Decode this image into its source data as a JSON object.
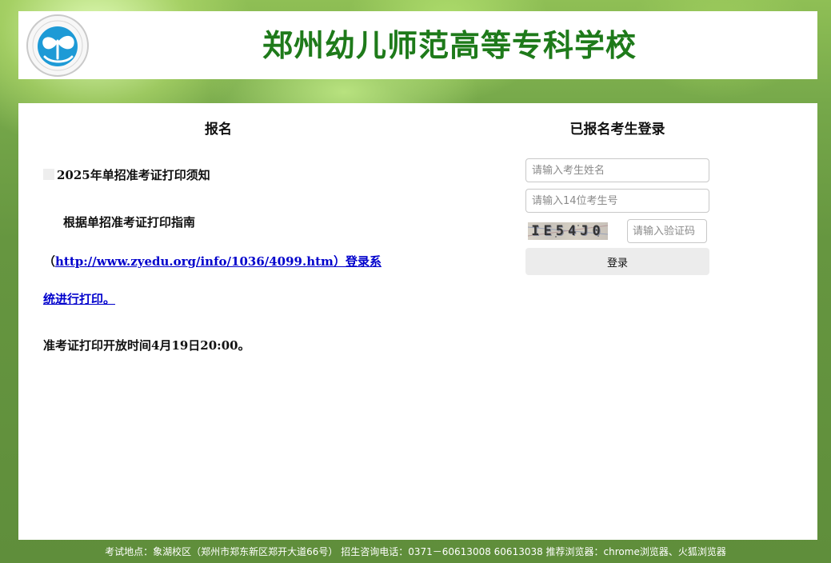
{
  "header": {
    "title": "郑州幼儿师范高等专科学校",
    "logo_icon": "school-logo-icon",
    "title_color": "#1e7a1a"
  },
  "registration": {
    "heading": "报名",
    "notice_title": "2025年单招准考证打印须知",
    "paragraph_intro": "根据单招准考证打印指南",
    "paragraph_open_paren": "（",
    "paragraph_link_url": "http://www.zyedu.org/info/1036/4099.htm",
    "paragraph_link_suffix": "）登录系",
    "paragraph_link_continued": "统进行打印。",
    "open_time_text": "准考证打印开放时间4月19日20:00。"
  },
  "login": {
    "heading": "已报名考生登录",
    "name_placeholder": "请输入考生姓名",
    "id_placeholder": "请输入14位考生号",
    "captcha_code": "IE54J0",
    "captcha_placeholder": "请输入验证码",
    "submit_label": "登录"
  },
  "footer": {
    "text": "考试地点：象湖校区（郑州市郑东新区郑开大道66号） 招生咨询电话：0371－60613008 60613038 推荐浏览器：chrome浏览器、火狐浏览器"
  },
  "colors": {
    "background_green": "#6a9940",
    "link_blue": "#0000cc",
    "button_gray": "#ececec"
  }
}
